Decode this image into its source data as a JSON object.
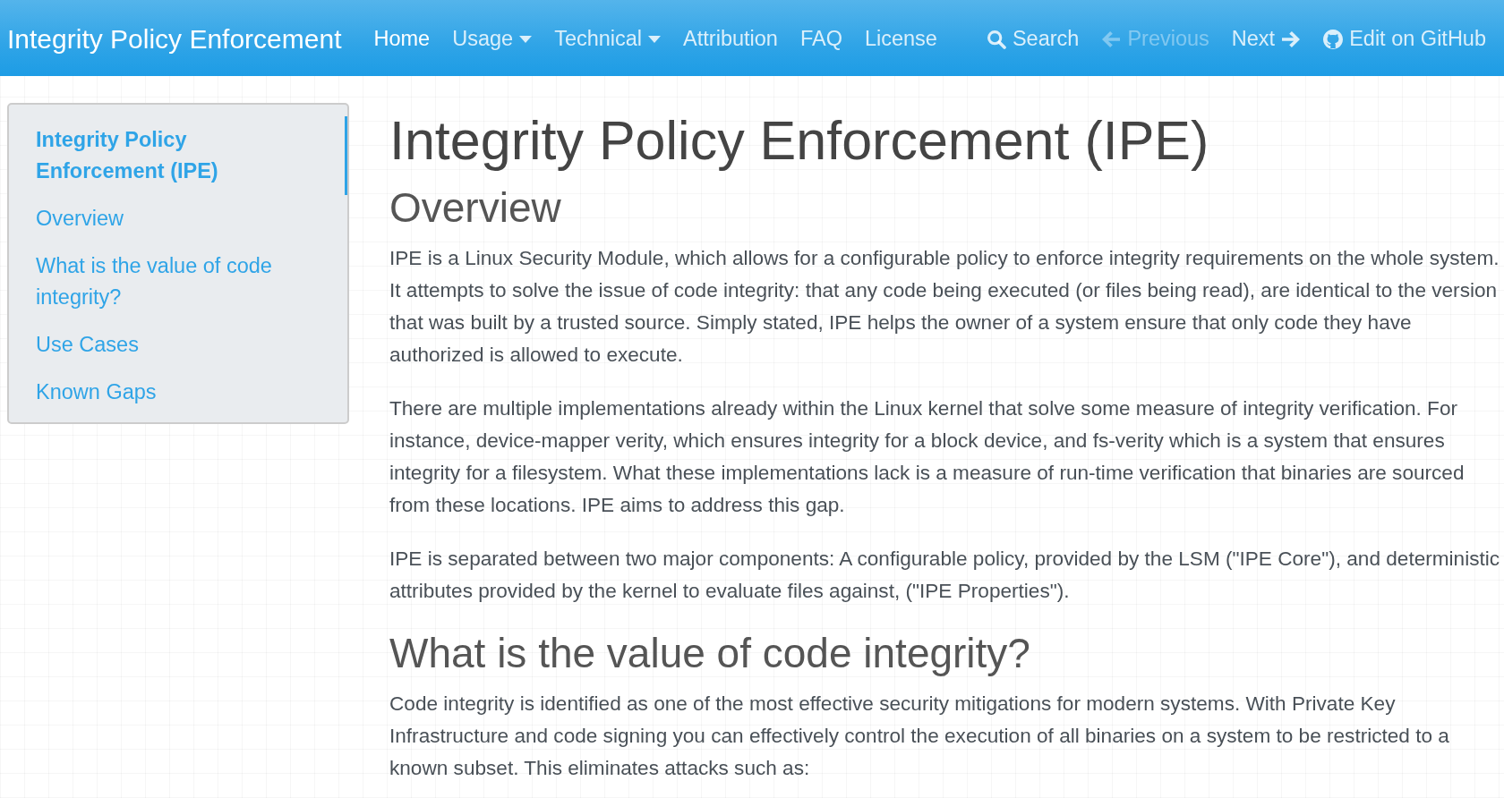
{
  "navbar": {
    "brand": "Integrity Policy Enforcement",
    "links": [
      {
        "label": "Home",
        "kind": "link",
        "selected": true
      },
      {
        "label": "Usage",
        "kind": "dropdown",
        "selected": false
      },
      {
        "label": "Technical",
        "kind": "dropdown",
        "selected": false
      },
      {
        "label": "Attribution",
        "kind": "link",
        "selected": false
      },
      {
        "label": "FAQ",
        "kind": "link",
        "selected": false
      },
      {
        "label": "License",
        "kind": "link",
        "selected": false
      }
    ],
    "actions": [
      {
        "label": "Search",
        "kind": "search",
        "disabled": false
      },
      {
        "label": "Previous",
        "kind": "previous",
        "disabled": true
      },
      {
        "label": "Next",
        "kind": "next",
        "disabled": false
      },
      {
        "label": "Edit on GitHub",
        "kind": "repository",
        "disabled": false
      }
    ]
  },
  "sidebar": {
    "items": [
      {
        "label": "Integrity Policy Enforcement (IPE)",
        "selected": true
      },
      {
        "label": "Overview",
        "selected": false
      },
      {
        "label": "What is the value of code integrity?",
        "selected": false
      },
      {
        "label": "Use Cases",
        "selected": false
      },
      {
        "label": "Known Gaps",
        "selected": false
      }
    ]
  },
  "content": {
    "blocks": [
      {
        "kind": "title",
        "text": "Integrity Policy Enforcement (IPE)"
      },
      {
        "kind": "heading",
        "text": "Overview"
      },
      {
        "kind": "paragraph",
        "text": "IPE is a Linux Security Module, which allows for a configurable policy to enforce integrity requirements on the whole system. It attempts to solve the issue of code integrity: that any code being executed (or files being read), are identical to the version that was built by a trusted source. Simply stated, IPE helps the owner of a system ensure that only code they have authorized is allowed to execute."
      },
      {
        "kind": "paragraph",
        "text": "There are multiple implementations already within the Linux kernel that solve some measure of integrity verification. For instance, device-mapper verity, which ensures integrity for a block device, and fs-verity which is a system that ensures integrity for a filesystem. What these implementations lack is a measure of run-time verification that binaries are sourced from these locations. IPE aims to address this gap."
      },
      {
        "kind": "paragraph",
        "text": "IPE is separated between two major components: A configurable policy, provided by the LSM (\"IPE Core\"), and deterministic attributes provided by the kernel to evaluate files against, (\"IPE Properties\")."
      },
      {
        "kind": "heading",
        "text": "What is the value of code integrity?"
      },
      {
        "kind": "paragraph",
        "text": "Code integrity is identified as one of the most effective security mitigations for modern systems. With Private Key Infrastructure and code signing you can effectively control the execution of all binaries on a system to be restricted to a known subset. This eliminates attacks such as:"
      }
    ]
  }
}
